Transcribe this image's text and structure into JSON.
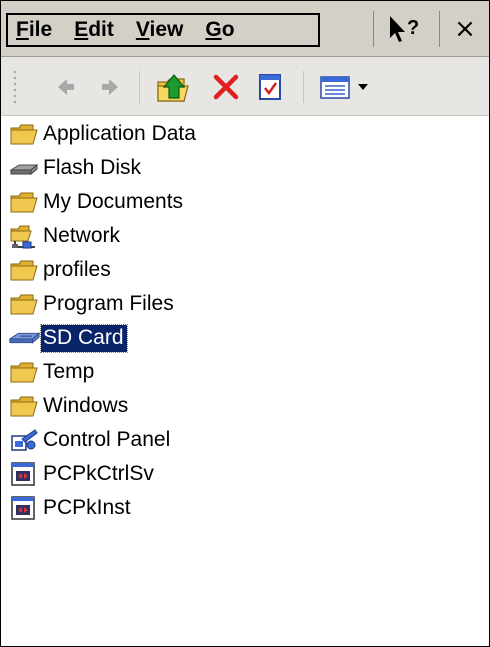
{
  "menu": {
    "items": [
      {
        "pre": "",
        "u": "F",
        "post": "ile"
      },
      {
        "pre": "",
        "u": "E",
        "post": "dit"
      },
      {
        "pre": "",
        "u": "V",
        "post": "iew"
      },
      {
        "pre": "",
        "u": "G",
        "post": "o"
      }
    ]
  },
  "titlebar": {
    "help_icon": "pointer-question-icon",
    "close_label": "×"
  },
  "toolbar": {
    "buttons": [
      "back-arrow-icon",
      "forward-arrow-icon",
      "up-folder-icon",
      "delete-x-icon",
      "properties-icon",
      "view-menu-icon"
    ]
  },
  "files": [
    {
      "name": "Application Data",
      "icon": "folder-icon"
    },
    {
      "name": "Flash Disk",
      "icon": "disk-drive-icon"
    },
    {
      "name": "My Documents",
      "icon": "folder-icon"
    },
    {
      "name": "Network",
      "icon": "network-icon"
    },
    {
      "name": "profiles",
      "icon": "folder-icon"
    },
    {
      "name": "Program Files",
      "icon": "folder-icon"
    },
    {
      "name": "SD Card",
      "icon": "sd-card-icon",
      "selected": true
    },
    {
      "name": "Temp",
      "icon": "folder-icon"
    },
    {
      "name": "Windows",
      "icon": "folder-icon"
    },
    {
      "name": "Control Panel",
      "icon": "control-panel-icon"
    },
    {
      "name": "PCPkCtrlSv",
      "icon": "executable-file-icon"
    },
    {
      "name": "PCPkInst",
      "icon": "executable-file-icon"
    }
  ],
  "colors": {
    "selection": "#0a246a",
    "folder": "#f0c040",
    "delete": "#e02020"
  }
}
